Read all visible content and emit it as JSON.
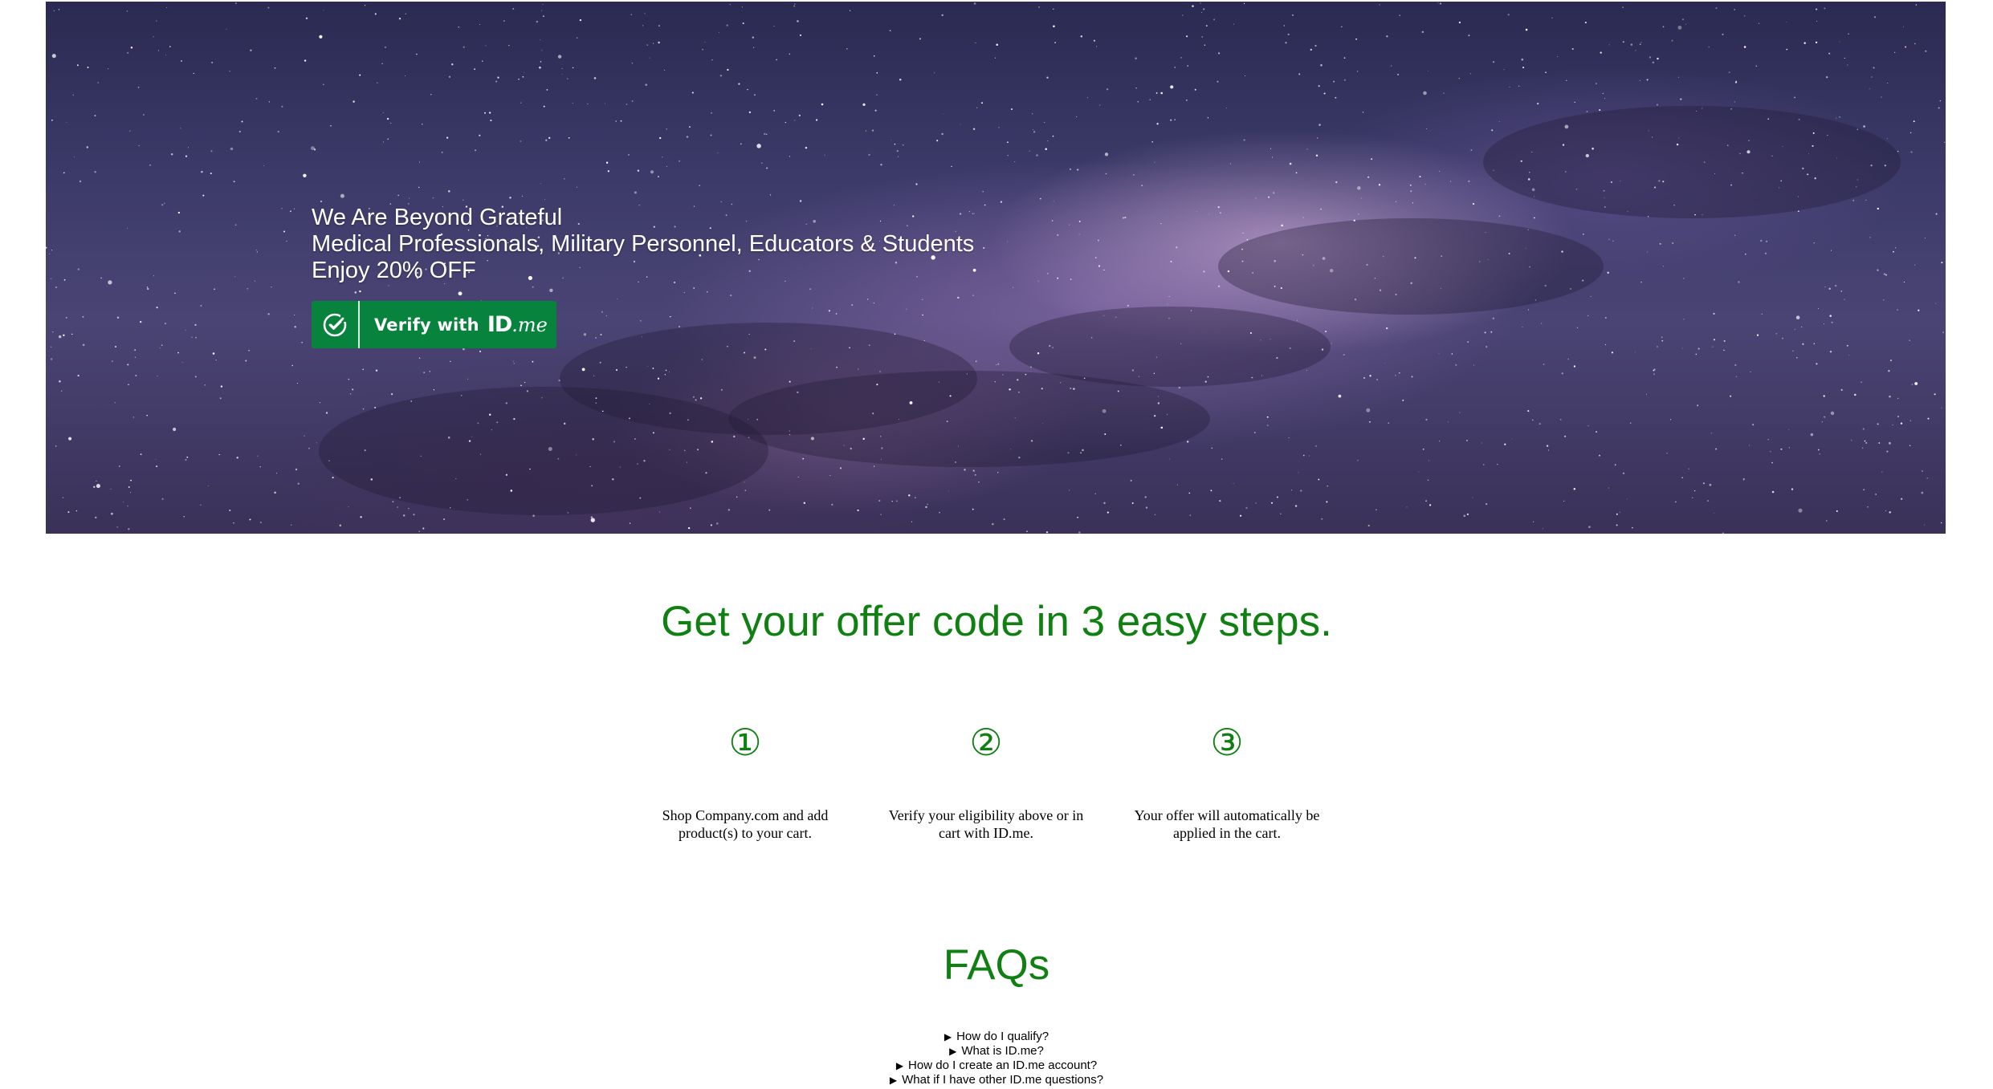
{
  "hero": {
    "line1": "We Are Beyond Grateful",
    "line2": "Medical Professionals, Military Personnel, Educators & Students",
    "line3": "Enjoy 20% OFF",
    "verify_label": "Verify with",
    "verify_brand_main": "ID",
    "verify_brand_suffix": ".me",
    "button_color": "#08833d"
  },
  "steps": {
    "title": "Get your offer code in 3 easy steps.",
    "accent_color": "#118012",
    "items": [
      {
        "number": "①",
        "text": "Shop Company.com and add product(s) to your cart."
      },
      {
        "number": "②",
        "text": "Verify your eligibility above or in cart with ID.me."
      },
      {
        "number": "③",
        "text": "Your offer will automatically be applied in the cart."
      }
    ]
  },
  "faq": {
    "title": "FAQs",
    "marker": "▶",
    "items": [
      "How do I qualify?",
      "What is ID.me?",
      "How do I create an ID.me account?",
      "What if I have other ID.me questions?"
    ]
  }
}
